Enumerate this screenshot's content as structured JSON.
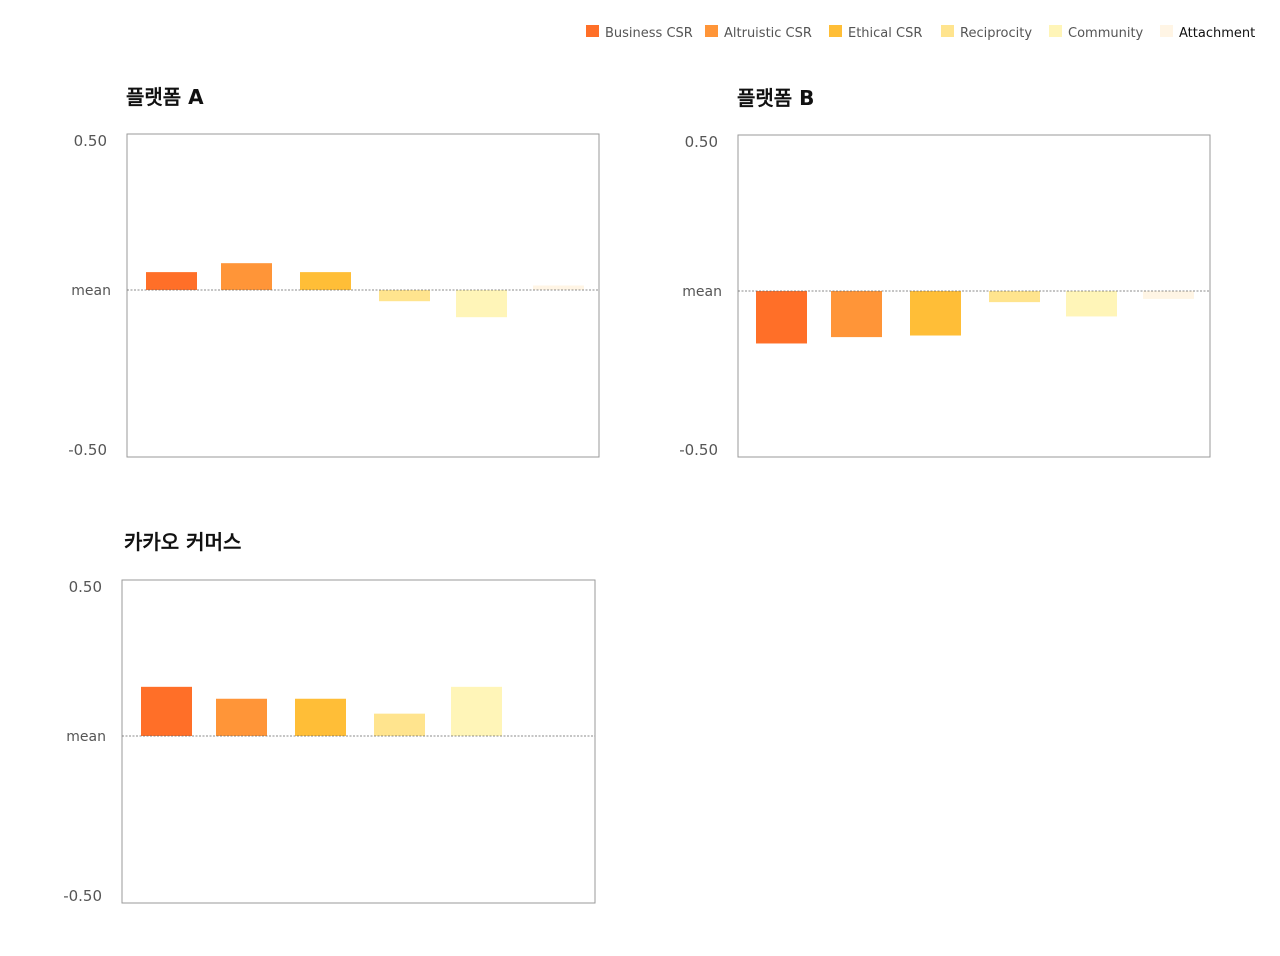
{
  "legend": [
    {
      "label": "Business CSR",
      "color": "#FF6F28"
    },
    {
      "label": "Altruistic CSR",
      "color": "#FF9538"
    },
    {
      "label": "Ethical  CSR",
      "color": "#FFBE37"
    },
    {
      "label": "Reciprocity",
      "color": "#FFE48E"
    },
    {
      "label": "Community",
      "color": "#FFF5B8"
    },
    {
      "label": "Attachment",
      "color": "#FFF5E5"
    }
  ],
  "chart_data": [
    {
      "type": "bar",
      "title": "플랫폼 A",
      "categories": [
        "Business CSR",
        "Altruistic CSR",
        "Ethical  CSR",
        "Reciprocity",
        "Community",
        "Attachment"
      ],
      "values": [
        0.06,
        0.09,
        0.06,
        -0.035,
        -0.085,
        0.015
      ],
      "ylim": [
        -0.5,
        0.5
      ],
      "y_ticks": [
        "0.50",
        "mean",
        "-0.50"
      ],
      "reference_line": "mean"
    },
    {
      "type": "bar",
      "title": "플랫폼 B",
      "categories": [
        "Business CSR",
        "Altruistic CSR",
        "Ethical  CSR",
        "Reciprocity",
        "Community",
        "Attachment"
      ],
      "values": [
        -0.165,
        -0.145,
        -0.14,
        -0.035,
        -0.08,
        -0.025
      ],
      "ylim": [
        -0.5,
        0.5
      ],
      "y_ticks": [
        "0.50",
        "mean",
        "-0.50"
      ],
      "reference_line": "mean"
    },
    {
      "type": "bar",
      "title": "카카오 커머스",
      "categories": [
        "Business CSR",
        "Altruistic CSR",
        "Ethical  CSR",
        "Reciprocity",
        "Community"
      ],
      "values": [
        0.165,
        0.125,
        0.125,
        0.075,
        0.165
      ],
      "ylim": [
        -0.5,
        0.5
      ],
      "y_ticks": [
        "0.50",
        "mean",
        "-0.50"
      ],
      "reference_line": "mean"
    }
  ]
}
